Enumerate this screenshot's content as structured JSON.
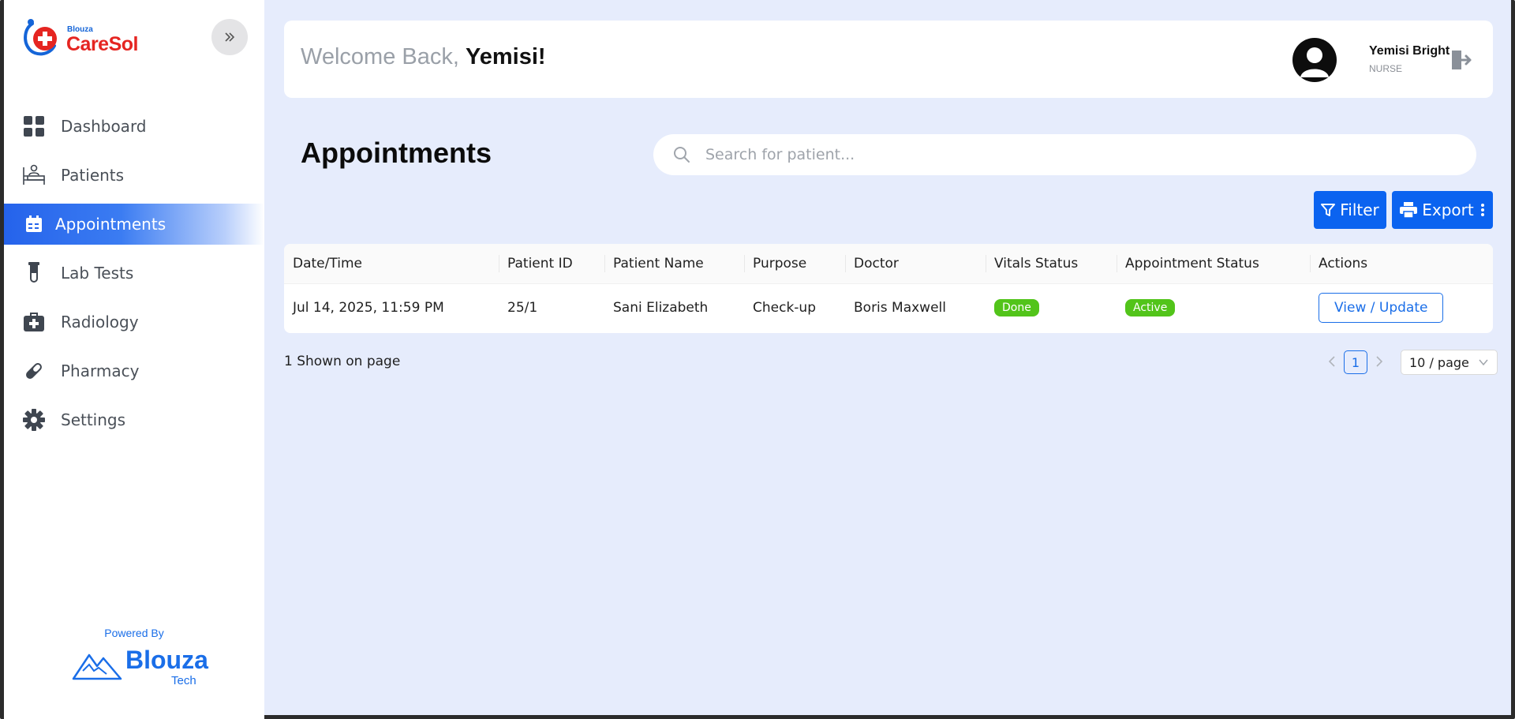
{
  "brand": {
    "logo_small": "Blouza",
    "logo_name": "CareSol",
    "powered_by": "Powered By",
    "footer_brand": "Blouza",
    "footer_sub": "Tech"
  },
  "sidebar": {
    "items": [
      {
        "label": "Dashboard",
        "icon": "grid-icon"
      },
      {
        "label": "Patients",
        "icon": "patient-bed-icon"
      },
      {
        "label": "Appointments",
        "icon": "calendar-icon",
        "active": true
      },
      {
        "label": "Lab Tests",
        "icon": "test-tube-icon"
      },
      {
        "label": "Radiology",
        "icon": "medical-kit-icon"
      },
      {
        "label": "Pharmacy",
        "icon": "pill-icon"
      },
      {
        "label": "Settings",
        "icon": "gear-icon"
      }
    ]
  },
  "header": {
    "welcome_prefix": "Welcome Back,",
    "welcome_name": "Yemisi!",
    "user_name": "Yemisi Bright",
    "user_role": "NURSE"
  },
  "main": {
    "title": "Appointments",
    "search_placeholder": "Search for patient...",
    "filter_label": "Filter",
    "export_label": "Export"
  },
  "table": {
    "columns": [
      "Date/Time",
      "Patient ID",
      "Patient Name",
      "Purpose",
      "Doctor",
      "Vitals Status",
      "Appointment Status",
      "Actions"
    ],
    "rows": [
      {
        "datetime": "Jul 14, 2025, 11:59 PM",
        "patient_id": "25/1",
        "patient_name": "Sani Elizabeth",
        "purpose": "Check-up",
        "doctor": "Boris Maxwell",
        "vitals_status": "Done",
        "appointment_status": "Active",
        "action_label": "View / Update"
      }
    ]
  },
  "pagination": {
    "shown_text": "1 Shown on page",
    "current_page": "1",
    "page_size": "10 / page"
  },
  "colors": {
    "primary": "#0b63f0",
    "background": "#e6ecfc",
    "badge_green": "#52c41a",
    "logo_red": "#e52521"
  }
}
